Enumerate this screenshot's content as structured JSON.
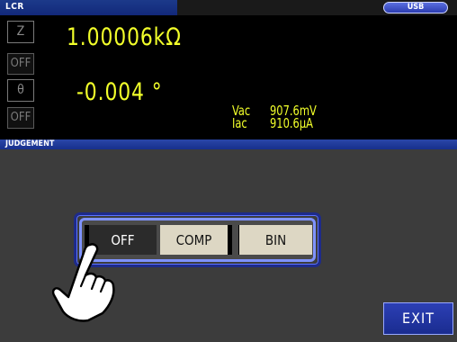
{
  "header": {
    "title": "LCR",
    "usb_label": "USB"
  },
  "measurement": {
    "param1": {
      "label": "Z",
      "value": "1.00006kΩ",
      "state": "OFF"
    },
    "param2": {
      "label": "θ",
      "value": "-0.004 °",
      "state": "OFF"
    },
    "monitor": {
      "vac": {
        "label": "Vac",
        "value": "907.6mV"
      },
      "iac": {
        "label": "Iac",
        "value": "910.6µA"
      }
    }
  },
  "judgement": {
    "title": "JUDGEMENT",
    "options": [
      "OFF",
      "COMP",
      "BIN"
    ],
    "selected": "OFF"
  },
  "exit_label": "EXIT",
  "colors": {
    "readout": "#f2ff2a",
    "accent_blue": "#1e2b8a",
    "panel": "#3c3c3c"
  }
}
